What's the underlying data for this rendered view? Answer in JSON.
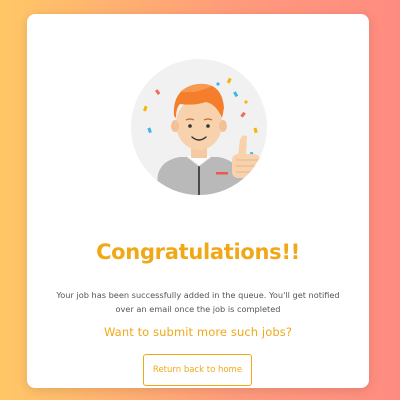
{
  "colors": {
    "accent": "#f0a818",
    "text_muted": "#555555",
    "background_start": "#ffc766",
    "background_end": "#ff8b80",
    "card": "#ffffff"
  },
  "success_card": {
    "illustration_icon": "thumbs-up-person-illustration",
    "title": "Congratulations!!",
    "message": "Your job has been successfully added in the queue. You'll get notified over an email once the job is completed",
    "question": "Want to submit more such jobs?",
    "button_label": "Return back to home"
  }
}
